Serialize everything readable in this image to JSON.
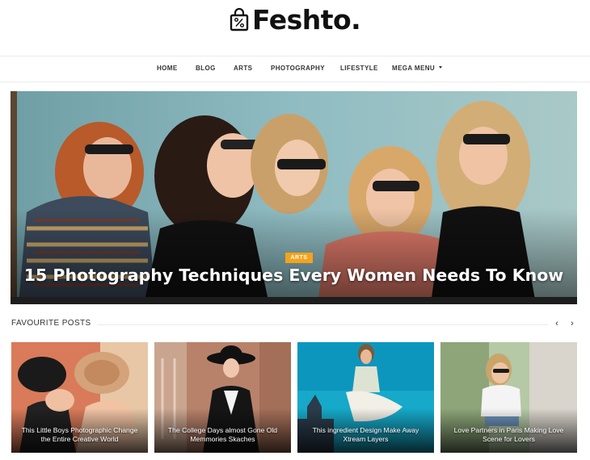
{
  "site": {
    "logo_text": "Feshto.",
    "logo_icon": "shopping-bag-percent-icon"
  },
  "nav": {
    "items": [
      {
        "label": "HOME"
      },
      {
        "label": "BLOG"
      },
      {
        "label": "ARTS"
      },
      {
        "label": "PHOTOGRAPHY"
      },
      {
        "label": "LIFESTYLE"
      },
      {
        "label": "MEGA MENU",
        "has_dropdown": true
      }
    ]
  },
  "hero": {
    "category": "ARTS",
    "title": "15 Photography Techniques Every Women Needs To Know",
    "category_color": "#f5a31a"
  },
  "favourites": {
    "title": "FAVOURITE POSTS",
    "prev_icon": "chevron-left-icon",
    "next_icon": "chevron-right-icon",
    "posts": [
      {
        "title": "This Little Boys Photographic Change the Entire Creative World"
      },
      {
        "title": "The College Days almost Gone Old Memmories Skaches"
      },
      {
        "title": "This ingredient Design Make Away Xtream Layers"
      },
      {
        "title": "Love Partners in Paris Making Love Scene for Lovers"
      }
    ]
  }
}
